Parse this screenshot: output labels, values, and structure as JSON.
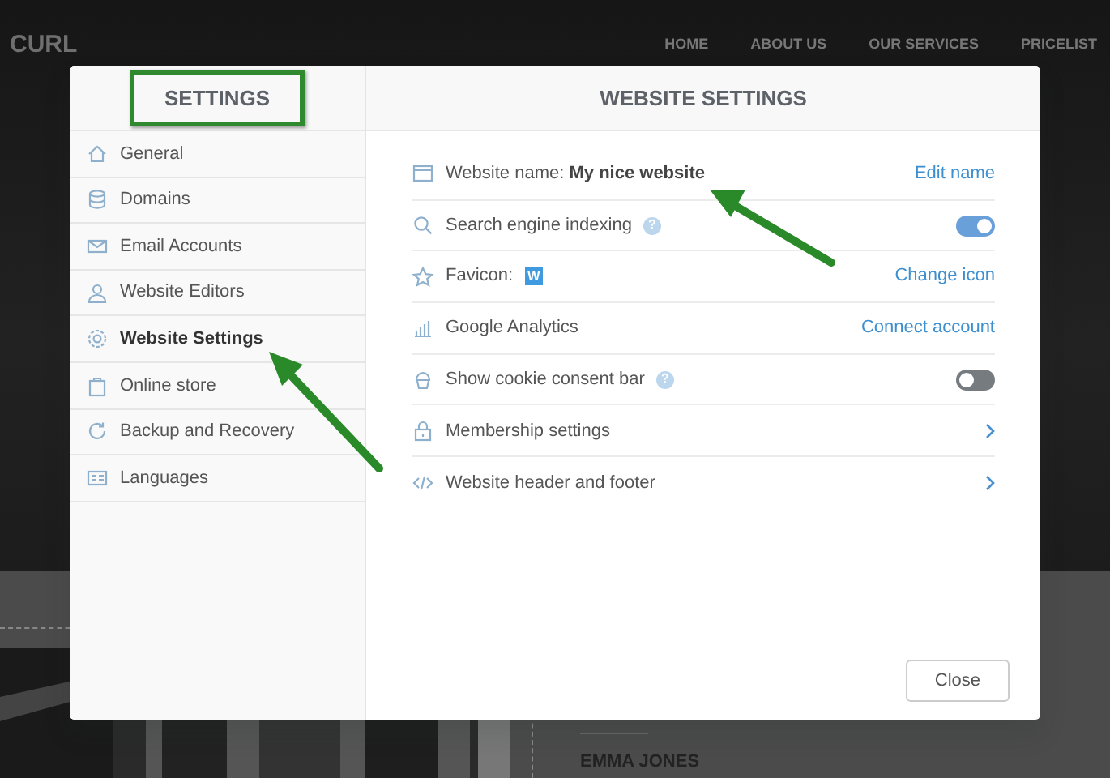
{
  "site": {
    "brand": "CURL",
    "nav": [
      "HOME",
      "ABOUT US",
      "OUR SERVICES",
      "PRICELIST"
    ],
    "person_name": "EMMA JONES"
  },
  "dialog": {
    "sidebar_title": "SETTINGS",
    "title": "WEBSITE SETTINGS",
    "sidebar_items": [
      {
        "label": "General",
        "selected": false
      },
      {
        "label": "Domains",
        "selected": false
      },
      {
        "label": "Email Accounts",
        "selected": false
      },
      {
        "label": "Website Editors",
        "selected": false
      },
      {
        "label": "Website Settings",
        "selected": true
      },
      {
        "label": "Online store",
        "selected": false
      },
      {
        "label": "Backup and Recovery",
        "selected": false
      },
      {
        "label": "Languages",
        "selected": false
      }
    ],
    "settings": [
      {
        "kind": "name",
        "label": "Website name:",
        "value": "My nice website",
        "action": "Edit name"
      },
      {
        "kind": "toggle",
        "label": "Search engine indexing",
        "help": "?",
        "on": true
      },
      {
        "kind": "favicon",
        "label": "Favicon:",
        "badge": "W",
        "action": "Change icon"
      },
      {
        "kind": "link",
        "label": "Google Analytics",
        "action": "Connect account"
      },
      {
        "kind": "toggle",
        "label": "Show cookie consent bar",
        "help": "?",
        "on": false
      },
      {
        "kind": "nav",
        "label": "Membership settings"
      },
      {
        "kind": "nav",
        "label": "Website header and footer"
      }
    ],
    "close_button": "Close"
  }
}
